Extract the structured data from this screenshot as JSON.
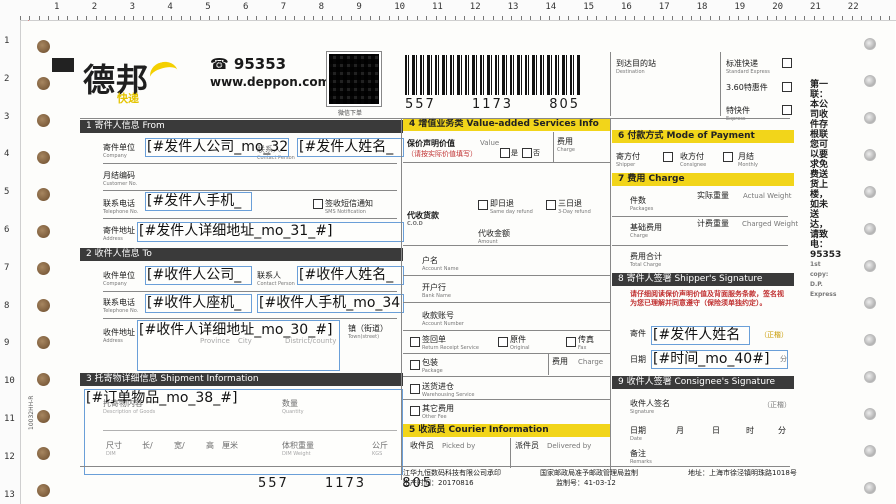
{
  "ruler": {
    "top_labels": [
      "1",
      "2",
      "3",
      "4",
      "5",
      "6",
      "7",
      "8",
      "9",
      "10",
      "11",
      "12",
      "13",
      "14",
      "15",
      "16",
      "17",
      "18",
      "19",
      "20",
      "21",
      "22"
    ],
    "left_labels": [
      "1",
      "2",
      "3",
      "4",
      "5",
      "6",
      "7",
      "8",
      "9",
      "10",
      "11",
      "12",
      "13"
    ]
  },
  "header": {
    "logo": "德邦",
    "logo_sub": "快递",
    "phone": "95353",
    "url": "www.deppon.com",
    "qr_caption": "微信下单",
    "barcode_digits": [
      "557",
      "1173",
      "805"
    ],
    "bottom_digits": [
      "557",
      "1173",
      "805"
    ]
  },
  "right_top": {
    "dest_label": "到达目的站",
    "dest_en": "Destination",
    "opt1": "标准快递",
    "opt1_en": "Standard Express",
    "opt2": "3.60特惠件",
    "opt3": "特快件",
    "opt3_en": "Express"
  },
  "vertical_note": "第一联：本公司收件存根联 您可以要求免费送货上楼，如未送达，请致电：95353",
  "vertical_note_en": "1st copy: D.P. Express",
  "sender": {
    "title": "1 寄件人信息 From",
    "company_label": "寄件单位",
    "company_en": "Company",
    "contact_label": "联系人",
    "contact_en": "Contact Person",
    "customer_label": "月结编码",
    "customer_en": "Customer No.",
    "phone_label": "联系电话",
    "phone_en": "Telephone No.",
    "sms_label": "签收短信通知",
    "sms_en": "SMS Notification",
    "address_label": "寄件地址",
    "address_en": "Address",
    "f_company": "[#发件人公司_mo_32",
    "f_name": "[#发件人姓名_",
    "f_phone": "[#发件人手机_",
    "f_address": "[#发件人详细地址_mo_31_#]"
  },
  "receiver": {
    "title": "2 收件人信息 To",
    "company_label": "收件单位",
    "company_en": "Company",
    "contact_label": "联系人",
    "contact_en": "Contact Person",
    "phone_label": "联系电话",
    "phone_en": "Telephone No.",
    "address_label": "收件地址",
    "address_en": "Address",
    "prov": "Province",
    "city": "City",
    "district": "District/county",
    "town_label": "镇（街道）",
    "town_en": "Town(street)",
    "f_company": "[#收件人公司_",
    "f_name": "[#收件人姓名_",
    "f_tel": "[#收件人座机_",
    "f_mobile": "[#收件人手机_mo_34",
    "f_address": "[#收件人详细地址_mo_30_#]"
  },
  "goods": {
    "title": "3 托寄物详细信息 Shipment Information",
    "desc_label": "托寄物内容",
    "desc_en": "Description of Goods",
    "qty_label": "数量",
    "qty_en": "Quantity",
    "size_label": "尺寸",
    "size_en": "DIM",
    "len": "长/",
    "wid": "宽/",
    "hei": "高",
    "unit": "厘米",
    "volw_label": "体积重量",
    "volw_en": "DIM Weight",
    "kg_label": "公斤",
    "kg_en": "KGS",
    "f_goods": "[#订单物品_mo_38_#]"
  },
  "value_added": {
    "title": "4 增值业务类 Value-added Services Info",
    "insured_label": "保价声明价值",
    "insured_note": "（请按实际价值填写）",
    "value_en": "Value",
    "yes": "是",
    "no": "否",
    "fee_label": "费用",
    "fee_en": "Charge",
    "cod_label": "代收货款",
    "cod_en": "C.O.D",
    "cod_next": "即日退",
    "cod_next_en": "Same day refund",
    "cod_3day": "三日退",
    "cod_3day_en": "3-Day refund",
    "cod_amount": "代收金额",
    "cod_amount_en": "Amount",
    "acct_name": "户名",
    "acct_name_en": "Account Name",
    "bank": "开户行",
    "bank_en": "Bank Name",
    "acct_no": "收款账号",
    "acct_no_en": "Account Number",
    "return_label": "签回单",
    "return_en": "Return Receipt Service",
    "orig": "原件",
    "orig_en": "Original",
    "fax": "传真",
    "fax_en": "Fax",
    "pack_label": "包装",
    "pack_en": "Package",
    "pack_fee": "费用",
    "pack_fee_en": "Charge",
    "warehouse_label": "送货进仓",
    "warehouse_en": "Warehousing Service",
    "other_label": "其它费用",
    "other_en": "Other Fee"
  },
  "courier": {
    "title": "5 收派员 Courier Information",
    "pick_label": "收件员",
    "pick_en": "Picked by",
    "deliv_label": "派件员",
    "deliv_en": "Delivered by"
  },
  "payment": {
    "title": "6 付款方式 Mode of Payment",
    "opt1": "寄方付",
    "opt1_en": "Shipper",
    "opt2": "收方付",
    "opt2_en": "Consignee",
    "opt3": "月结",
    "opt3_en": "Monthly"
  },
  "charge": {
    "title": "7 费用 Charge",
    "pieces": "件数",
    "pieces_en": "Packages",
    "actual_w": "实际重量",
    "actual_w_en": "Actual Weight",
    "base_fee": "基础费用",
    "base_fee_en": "Charge",
    "charged_w": "计费重量",
    "charged_w_en": "Charged Weight",
    "total": "费用合计",
    "total_en": "Total Charge"
  },
  "shipper_sign": {
    "title": "8 寄件人签署 Shipper's Signature",
    "notice": "请仔细阅读保价声明价值及背面服务条款，签名视为您已理解并同意遵守（保险须单独约定）。",
    "sign_label": "寄件",
    "stamp": "（正楷）",
    "date_label": "日期",
    "f_sender": "[#发件人姓名",
    "f_time": "[#时间_mo_40#]",
    "minute": "分"
  },
  "consignee_sign": {
    "title": "9 收件人签署 Consignee's Signature",
    "sign_label": "收件人签名",
    "sign_en": "Signature",
    "stamp": "（正楷）",
    "date_label": "日期",
    "date_en": "Date",
    "month": "月",
    "day": "日",
    "hour": "时",
    "minute": "分",
    "remark": "备注",
    "remark_en": "Remarks"
  },
  "footer": {
    "printer": "江华九恒数码科技有限公司承印",
    "prod_date_label": "生产时间：",
    "prod_date": "20170816",
    "permit": "国家邮政局准予邮政管理局监制",
    "code": "监制号：41-03-12",
    "address": "地址：上海市徐泾镇明珠路1018号",
    "side_code": "10032HH-R"
  }
}
